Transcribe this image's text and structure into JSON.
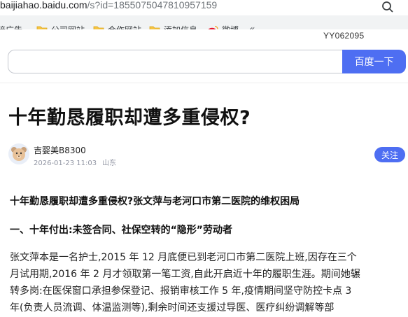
{
  "browser": {
    "url_host": "baijiahao.baidu.com",
    "url_path": "/s?id=1855075047810957159",
    "bookmarks": [
      {
        "label": "接广告"
      },
      {
        "label": "公司网站"
      },
      {
        "label": "合作网站"
      },
      {
        "label": "添加信息"
      },
      {
        "label": "微博 -"
      }
    ],
    "more": "«"
  },
  "watermark": "YY062095",
  "search": {
    "value": "",
    "button_label": "百度一下"
  },
  "article": {
    "title": "十年勤恳履职却遭多重侵权?",
    "author": "吉婴美B8300",
    "date": "2026-01-23 11:03",
    "location": "山东",
    "follow_label": "关注",
    "subtitle": "十年勤恳履职却遭多重侵权?张文萍与老河口市第二医院的维权困局",
    "section_heading": "一、十年付出:未签合同、社保空转的“隐形”劳动者",
    "paragraph_lines": [
      "张文萍本是一名护士,2015 年 12 月底便已到老河口市第二医院上班,因存在三个",
      "月试用期,2016 年 2 月才领取第一笔工资,自此开启近十年的履职生涯。期间她辗",
      "转多岗:在医保窗口承担参保登记、报销审核工作 5 年,疫情期间坚守防控卡点 3",
      "年(负责人员流调、体温监测等),剩余时间还支援过导医、医疗纠纷调解等部"
    ]
  },
  "colors": {
    "accent": "#4e6ef2",
    "bookmark_bar": "#f1f3f4"
  }
}
